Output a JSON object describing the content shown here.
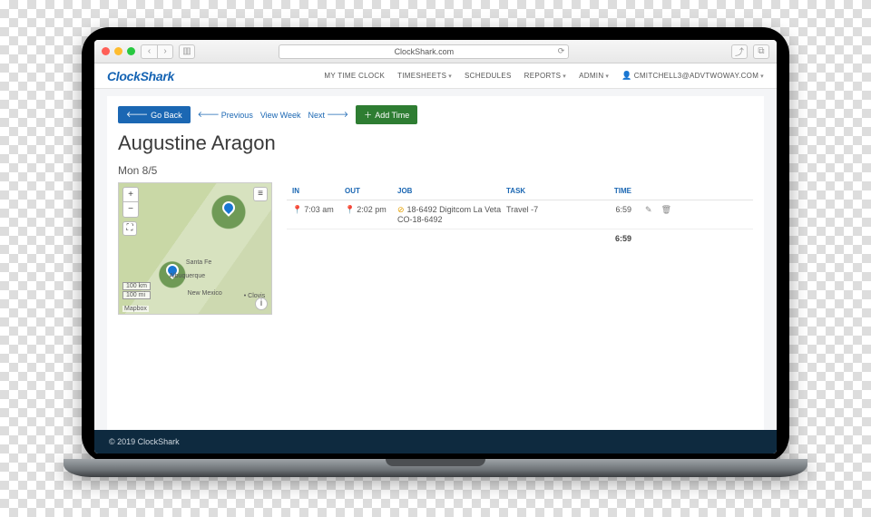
{
  "browser": {
    "url": "ClockShark.com"
  },
  "brand": {
    "name": "ClockShark"
  },
  "nav": {
    "my_time_clock": "MY TIME CLOCK",
    "timesheets": "TIMESHEETS",
    "schedules": "SCHEDULES",
    "reports": "REPORTS",
    "admin": "ADMIN",
    "user": "CMITCHELL3@ADVTWOWAY.COM"
  },
  "toolbar": {
    "go_back": "Go Back",
    "previous": "Previous",
    "view_week": "View Week",
    "next": "Next",
    "add_time": "Add Time"
  },
  "page_title": "Augustine Aragon",
  "day_label": "Mon 8/5",
  "map": {
    "scale_km": "100 km",
    "scale_mi": "100 mi",
    "attr": "Mapbox",
    "cities": {
      "santa_fe": "Santa Fe",
      "albuquerque": "Albuquerque",
      "new_mexico": "New Mexico",
      "clovis": "Clovis"
    }
  },
  "table": {
    "headers": {
      "in": "IN",
      "out": "OUT",
      "job": "JOB",
      "task": "TASK",
      "time": "TIME"
    },
    "rows": [
      {
        "in": "7:03 am",
        "out": "2:02 pm",
        "job": "18-6492 Digitcom La Veta CO-18-6492",
        "task": "Travel -7",
        "time": "6:59"
      }
    ],
    "total": "6:59"
  },
  "footer": "© 2019 ClockShark"
}
